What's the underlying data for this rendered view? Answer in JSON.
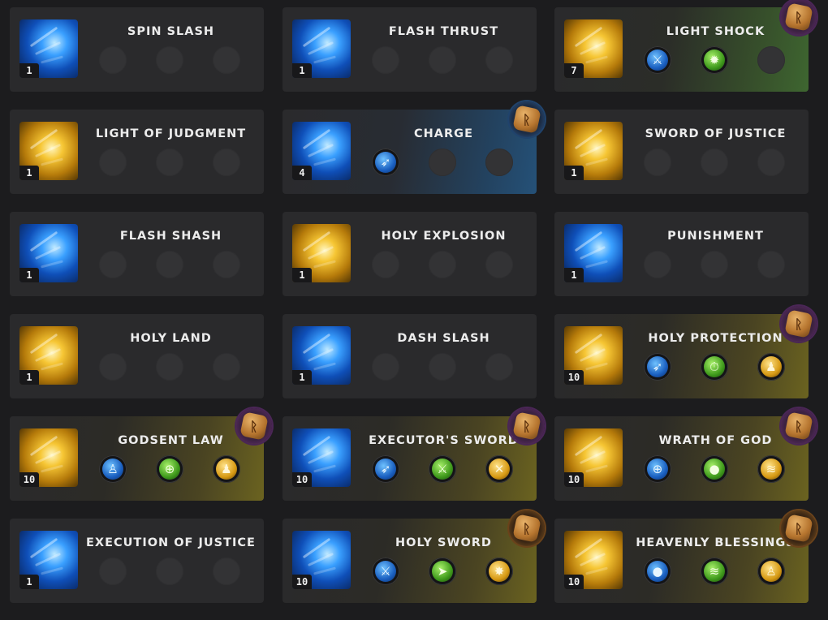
{
  "skills": [
    {
      "name": "SPIN SLASH",
      "level": "1",
      "element": "blue",
      "tint": "none",
      "rune": null,
      "mods": []
    },
    {
      "name": "FLASH THRUST",
      "level": "1",
      "element": "blue",
      "tint": "none",
      "rune": null,
      "mods": []
    },
    {
      "name": "LIGHT SHOCK",
      "level": "7",
      "element": "gold",
      "tint": "green",
      "rune": "purple",
      "mods": [
        {
          "icon": "sword-ground-icon",
          "color": "blue",
          "glyph": "⚔"
        },
        {
          "icon": "gear-burst-icon",
          "color": "green",
          "glyph": "✹"
        }
      ]
    },
    {
      "name": "LIGHT OF JUDGMENT",
      "level": "1",
      "element": "gold",
      "tint": "none",
      "rune": null,
      "mods": []
    },
    {
      "name": "CHARGE",
      "level": "4",
      "element": "blue",
      "tint": "blue",
      "rune": "blue",
      "mods": [
        {
          "icon": "dash-runner-icon",
          "color": "blue",
          "glyph": "➶"
        }
      ]
    },
    {
      "name": "SWORD OF JUSTICE",
      "level": "1",
      "element": "gold",
      "tint": "none",
      "rune": null,
      "mods": []
    },
    {
      "name": "FLASH SHASH",
      "level": "1",
      "element": "blue",
      "tint": "none",
      "rune": null,
      "mods": []
    },
    {
      "name": "HOLY EXPLOSION",
      "level": "1",
      "element": "gold",
      "tint": "none",
      "rune": null,
      "mods": []
    },
    {
      "name": "PUNISHMENT",
      "level": "1",
      "element": "blue",
      "tint": "none",
      "rune": null,
      "mods": []
    },
    {
      "name": "HOLY LAND",
      "level": "1",
      "element": "gold",
      "tint": "none",
      "rune": null,
      "mods": []
    },
    {
      "name": "DASH SLASH",
      "level": "1",
      "element": "blue",
      "tint": "none",
      "rune": null,
      "mods": []
    },
    {
      "name": "HOLY PROTECTION",
      "level": "10",
      "element": "gold",
      "tint": "gold",
      "rune": "purple",
      "mods": [
        {
          "icon": "sprint-icon",
          "color": "blue",
          "glyph": "➶"
        },
        {
          "icon": "stopwatch-icon",
          "color": "green",
          "glyph": "⏱"
        },
        {
          "icon": "party-icon",
          "color": "gold",
          "glyph": "♟"
        }
      ]
    },
    {
      "name": "GODSENT LAW",
      "level": "10",
      "element": "gold",
      "tint": "gold",
      "rune": "purple",
      "mods": [
        {
          "icon": "person-icon",
          "color": "blue",
          "glyph": "♙"
        },
        {
          "icon": "target-crosshair-icon",
          "color": "green",
          "glyph": "⊕"
        },
        {
          "icon": "party-icon",
          "color": "gold",
          "glyph": "♟"
        }
      ]
    },
    {
      "name": "EXECUTOR'S SWORD",
      "level": "10",
      "element": "blue",
      "tint": "gold",
      "rune": "purple",
      "mods": [
        {
          "icon": "dash-runner-icon",
          "color": "blue",
          "glyph": "➶"
        },
        {
          "icon": "sword-sweep-icon",
          "color": "green",
          "glyph": "⚔"
        },
        {
          "icon": "crossed-arrows-icon",
          "color": "gold",
          "glyph": "✕"
        }
      ]
    },
    {
      "name": "WRATH OF GOD",
      "level": "10",
      "element": "gold",
      "tint": "gold",
      "rune": "purple",
      "mods": [
        {
          "icon": "target-crosshair-icon",
          "color": "blue",
          "glyph": "⊕"
        },
        {
          "icon": "orb-up-icon",
          "color": "green",
          "glyph": "●"
        },
        {
          "icon": "slash-claws-icon",
          "color": "gold",
          "glyph": "≋"
        }
      ]
    },
    {
      "name": "EXECUTION OF JUSTICE",
      "level": "1",
      "element": "blue",
      "tint": "none",
      "rune": null,
      "mods": []
    },
    {
      "name": "HOLY SWORD",
      "level": "10",
      "element": "blue",
      "tint": "gold",
      "rune": "orange",
      "mods": [
        {
          "icon": "sword-ground-icon",
          "color": "blue",
          "glyph": "⚔"
        },
        {
          "icon": "energy-beam-icon",
          "color": "green",
          "glyph": "➤"
        },
        {
          "icon": "sparkle-burst-icon",
          "color": "gold",
          "glyph": "✸"
        }
      ]
    },
    {
      "name": "HEAVENLY BLESSINGS",
      "level": "10",
      "element": "gold",
      "tint": "gold",
      "rune": "orange",
      "mods": [
        {
          "icon": "orb-up-icon",
          "color": "blue",
          "glyph": "●"
        },
        {
          "icon": "slash-claws-icon",
          "color": "green",
          "glyph": "≋"
        },
        {
          "icon": "person-icon",
          "color": "gold",
          "glyph": "♙"
        }
      ]
    }
  ]
}
